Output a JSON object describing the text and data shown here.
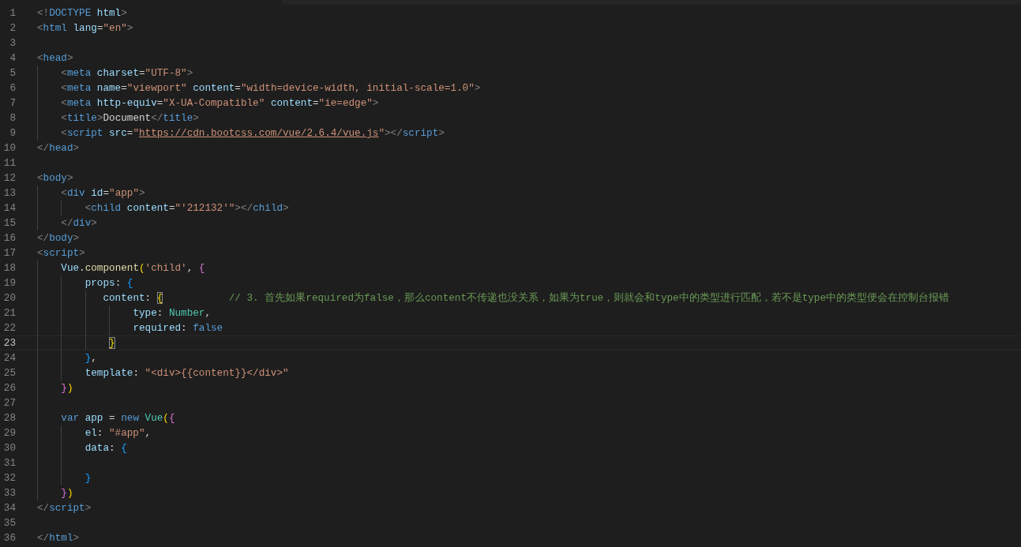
{
  "editor": {
    "lines": [
      {
        "number": "1",
        "current": false,
        "tokens": [
          {
            "t": "<!",
            "kind": "p"
          },
          {
            "t": "DOCTYPE",
            "kind": "tag"
          },
          {
            "t": " html",
            "kind": "attr"
          },
          {
            "t": ">",
            "kind": "p"
          }
        ]
      },
      {
        "number": "2",
        "current": false,
        "tokens": [
          {
            "t": "<",
            "kind": "p"
          },
          {
            "t": "html",
            "kind": "tag"
          },
          {
            "t": " lang",
            "kind": "attr"
          },
          {
            "t": "=",
            "kind": "op"
          },
          {
            "t": "\"en\"",
            "kind": "str"
          },
          {
            "t": ">",
            "kind": "p"
          }
        ]
      },
      {
        "number": "3",
        "current": false
      },
      {
        "number": "4",
        "current": false,
        "tokens": [
          {
            "t": "<",
            "kind": "p"
          },
          {
            "t": "head",
            "kind": "tag"
          },
          {
            "t": ">",
            "kind": "p"
          }
        ]
      },
      {
        "number": "5",
        "current": false,
        "tokens": [
          {
            "t": "    <",
            "kind": "p"
          },
          {
            "t": "meta",
            "kind": "tag"
          },
          {
            "t": " charset",
            "kind": "attr"
          },
          {
            "t": "=",
            "kind": "op"
          },
          {
            "t": "\"UTF-8\"",
            "kind": "str"
          },
          {
            "t": ">",
            "kind": "p"
          }
        ]
      },
      {
        "number": "6",
        "current": false,
        "tokens": [
          {
            "t": "    <",
            "kind": "p"
          },
          {
            "t": "meta",
            "kind": "tag"
          },
          {
            "t": " name",
            "kind": "attr"
          },
          {
            "t": "=",
            "kind": "op"
          },
          {
            "t": "\"viewport\"",
            "kind": "str"
          },
          {
            "t": " content",
            "kind": "attr"
          },
          {
            "t": "=",
            "kind": "op"
          },
          {
            "t": "\"width=device-width, initial-scale=1.0\"",
            "kind": "str"
          },
          {
            "t": ">",
            "kind": "p"
          }
        ]
      },
      {
        "number": "7",
        "current": false,
        "tokens": [
          {
            "t": "    <",
            "kind": "p"
          },
          {
            "t": "meta",
            "kind": "tag"
          },
          {
            "t": " http-equiv",
            "kind": "attr"
          },
          {
            "t": "=",
            "kind": "op"
          },
          {
            "t": "\"X-UA-Compatible\"",
            "kind": "str"
          },
          {
            "t": " content",
            "kind": "attr"
          },
          {
            "t": "=",
            "kind": "op"
          },
          {
            "t": "\"ie=edge\"",
            "kind": "str"
          },
          {
            "t": ">",
            "kind": "p"
          }
        ]
      },
      {
        "number": "8",
        "current": false,
        "tokens": [
          {
            "t": "    <",
            "kind": "p"
          },
          {
            "t": "title",
            "kind": "tag"
          },
          {
            "t": ">",
            "kind": "p"
          },
          {
            "t": "Document",
            "kind": "text"
          },
          {
            "t": "</",
            "kind": "p"
          },
          {
            "t": "title",
            "kind": "tag"
          },
          {
            "t": ">",
            "kind": "p"
          }
        ]
      },
      {
        "number": "9",
        "current": false,
        "tokens": [
          {
            "t": "    <",
            "kind": "p"
          },
          {
            "t": "script",
            "kind": "tag"
          },
          {
            "t": " src",
            "kind": "attr"
          },
          {
            "t": "=",
            "kind": "op"
          },
          {
            "t": "\"",
            "kind": "str"
          },
          {
            "t": "https://cdn.bootcss.com/vue/2.6.4/vue.js",
            "kind": "link"
          },
          {
            "t": "\"",
            "kind": "str"
          },
          {
            "t": "></",
            "kind": "p"
          },
          {
            "t": "script",
            "kind": "tag"
          },
          {
            "t": ">",
            "kind": "p"
          }
        ]
      },
      {
        "number": "10",
        "current": false,
        "tokens": [
          {
            "t": "</",
            "kind": "p"
          },
          {
            "t": "head",
            "kind": "tag"
          },
          {
            "t": ">",
            "kind": "p"
          }
        ]
      },
      {
        "number": "11",
        "current": false
      },
      {
        "number": "12",
        "current": false,
        "tokens": [
          {
            "t": "<",
            "kind": "p"
          },
          {
            "t": "body",
            "kind": "tag"
          },
          {
            "t": ">",
            "kind": "p"
          }
        ]
      },
      {
        "number": "13",
        "current": false,
        "tokens": [
          {
            "t": "    <",
            "kind": "p"
          },
          {
            "t": "div",
            "kind": "tag"
          },
          {
            "t": " id",
            "kind": "attr"
          },
          {
            "t": "=",
            "kind": "op"
          },
          {
            "t": "\"app\"",
            "kind": "str"
          },
          {
            "t": ">",
            "kind": "p"
          }
        ]
      },
      {
        "number": "14",
        "current": false,
        "tokens": [
          {
            "t": "        <",
            "kind": "p"
          },
          {
            "t": "child",
            "kind": "tag"
          },
          {
            "t": " content",
            "kind": "attr"
          },
          {
            "t": "=",
            "kind": "op"
          },
          {
            "t": "\"'212132'\"",
            "kind": "str"
          },
          {
            "t": "></",
            "kind": "p"
          },
          {
            "t": "child",
            "kind": "tag"
          },
          {
            "t": ">",
            "kind": "p"
          }
        ]
      },
      {
        "number": "15",
        "current": false,
        "tokens": [
          {
            "t": "    </",
            "kind": "p"
          },
          {
            "t": "div",
            "kind": "tag"
          },
          {
            "t": ">",
            "kind": "p"
          }
        ]
      },
      {
        "number": "16",
        "current": false,
        "tokens": [
          {
            "t": "</",
            "kind": "p"
          },
          {
            "t": "body",
            "kind": "tag"
          },
          {
            "t": ">",
            "kind": "p"
          }
        ]
      },
      {
        "number": "17",
        "current": false,
        "tokens": [
          {
            "t": "<",
            "kind": "p"
          },
          {
            "t": "script",
            "kind": "tag"
          },
          {
            "t": ">",
            "kind": "p"
          }
        ]
      },
      {
        "number": "18",
        "current": false,
        "tokens": [
          {
            "t": "    Vue",
            "kind": "var"
          },
          {
            "t": ".",
            "kind": "op"
          },
          {
            "t": "component",
            "kind": "fn"
          },
          {
            "t": "(",
            "kind": "b1"
          },
          {
            "t": "'child'",
            "kind": "str"
          },
          {
            "t": ", ",
            "kind": "op"
          },
          {
            "t": "{",
            "kind": "b2"
          }
        ]
      },
      {
        "number": "19",
        "current": false,
        "tokens": [
          {
            "t": "        props",
            "kind": "var"
          },
          {
            "t": ": ",
            "kind": "op"
          },
          {
            "t": "{",
            "kind": "b3"
          }
        ]
      },
      {
        "number": "20",
        "current": false,
        "tokens": [
          {
            "t": "           content",
            "kind": "var"
          },
          {
            "t": ": ",
            "kind": "op"
          },
          {
            "t": "{",
            "kind": "match"
          },
          {
            "t": "           // 3. 首先如果required为false，那么content不传递也没关系，如果为true，则就会和type中的类型进行匹配，若不是type中的类型便会在控制台报错",
            "kind": "comment"
          }
        ]
      },
      {
        "number": "21",
        "current": false,
        "tokens": [
          {
            "t": "                type",
            "kind": "var"
          },
          {
            "t": ": ",
            "kind": "op"
          },
          {
            "t": "Number",
            "kind": "type"
          },
          {
            "t": ",",
            "kind": "op"
          }
        ]
      },
      {
        "number": "22",
        "current": false,
        "tokens": [
          {
            "t": "                required",
            "kind": "var"
          },
          {
            "t": ": ",
            "kind": "op"
          },
          {
            "t": "false",
            "kind": "kw"
          }
        ]
      },
      {
        "number": "23",
        "current": true,
        "tokens": [
          {
            "t": "            }",
            "kind": "match"
          }
        ]
      },
      {
        "number": "24",
        "current": false,
        "tokens": [
          {
            "t": "        }",
            "kind": "b3"
          },
          {
            "t": ",",
            "kind": "op"
          }
        ]
      },
      {
        "number": "25",
        "current": false,
        "tokens": [
          {
            "t": "        template",
            "kind": "var"
          },
          {
            "t": ": ",
            "kind": "op"
          },
          {
            "t": "\"<div>{{content}}</div>\"",
            "kind": "str"
          }
        ]
      },
      {
        "number": "26",
        "current": false,
        "tokens": [
          {
            "t": "    }",
            "kind": "b2"
          },
          {
            "t": ")",
            "kind": "b1"
          }
        ]
      },
      {
        "number": "27",
        "current": false
      },
      {
        "number": "28",
        "current": false,
        "tokens": [
          {
            "t": "    var",
            "kind": "kw"
          },
          {
            "t": " app",
            "kind": "var"
          },
          {
            "t": " = ",
            "kind": "op"
          },
          {
            "t": "new",
            "kind": "kw"
          },
          {
            "t": " Vue",
            "kind": "type"
          },
          {
            "t": "(",
            "kind": "b1"
          },
          {
            "t": "{",
            "kind": "b2"
          }
        ]
      },
      {
        "number": "29",
        "current": false,
        "tokens": [
          {
            "t": "        el",
            "kind": "var"
          },
          {
            "t": ": ",
            "kind": "op"
          },
          {
            "t": "\"#app\"",
            "kind": "str"
          },
          {
            "t": ",",
            "kind": "op"
          }
        ]
      },
      {
        "number": "30",
        "current": false,
        "tokens": [
          {
            "t": "        data",
            "kind": "var"
          },
          {
            "t": ": ",
            "kind": "op"
          },
          {
            "t": "{",
            "kind": "b3"
          }
        ]
      },
      {
        "number": "31",
        "current": false
      },
      {
        "number": "32",
        "current": false,
        "tokens": [
          {
            "t": "        }",
            "kind": "b3"
          }
        ]
      },
      {
        "number": "33",
        "current": false,
        "tokens": [
          {
            "t": "    }",
            "kind": "b2"
          },
          {
            "t": ")",
            "kind": "b1"
          }
        ]
      },
      {
        "number": "34",
        "current": false,
        "tokens": [
          {
            "t": "</",
            "kind": "p"
          },
          {
            "t": "script",
            "kind": "tag"
          },
          {
            "t": ">",
            "kind": "p"
          }
        ]
      },
      {
        "number": "35",
        "current": false
      },
      {
        "number": "36",
        "current": false,
        "tokens": [
          {
            "t": "</",
            "kind": "p"
          },
          {
            "t": "html",
            "kind": "tag"
          },
          {
            "t": ">",
            "kind": "p"
          }
        ]
      }
    ]
  }
}
